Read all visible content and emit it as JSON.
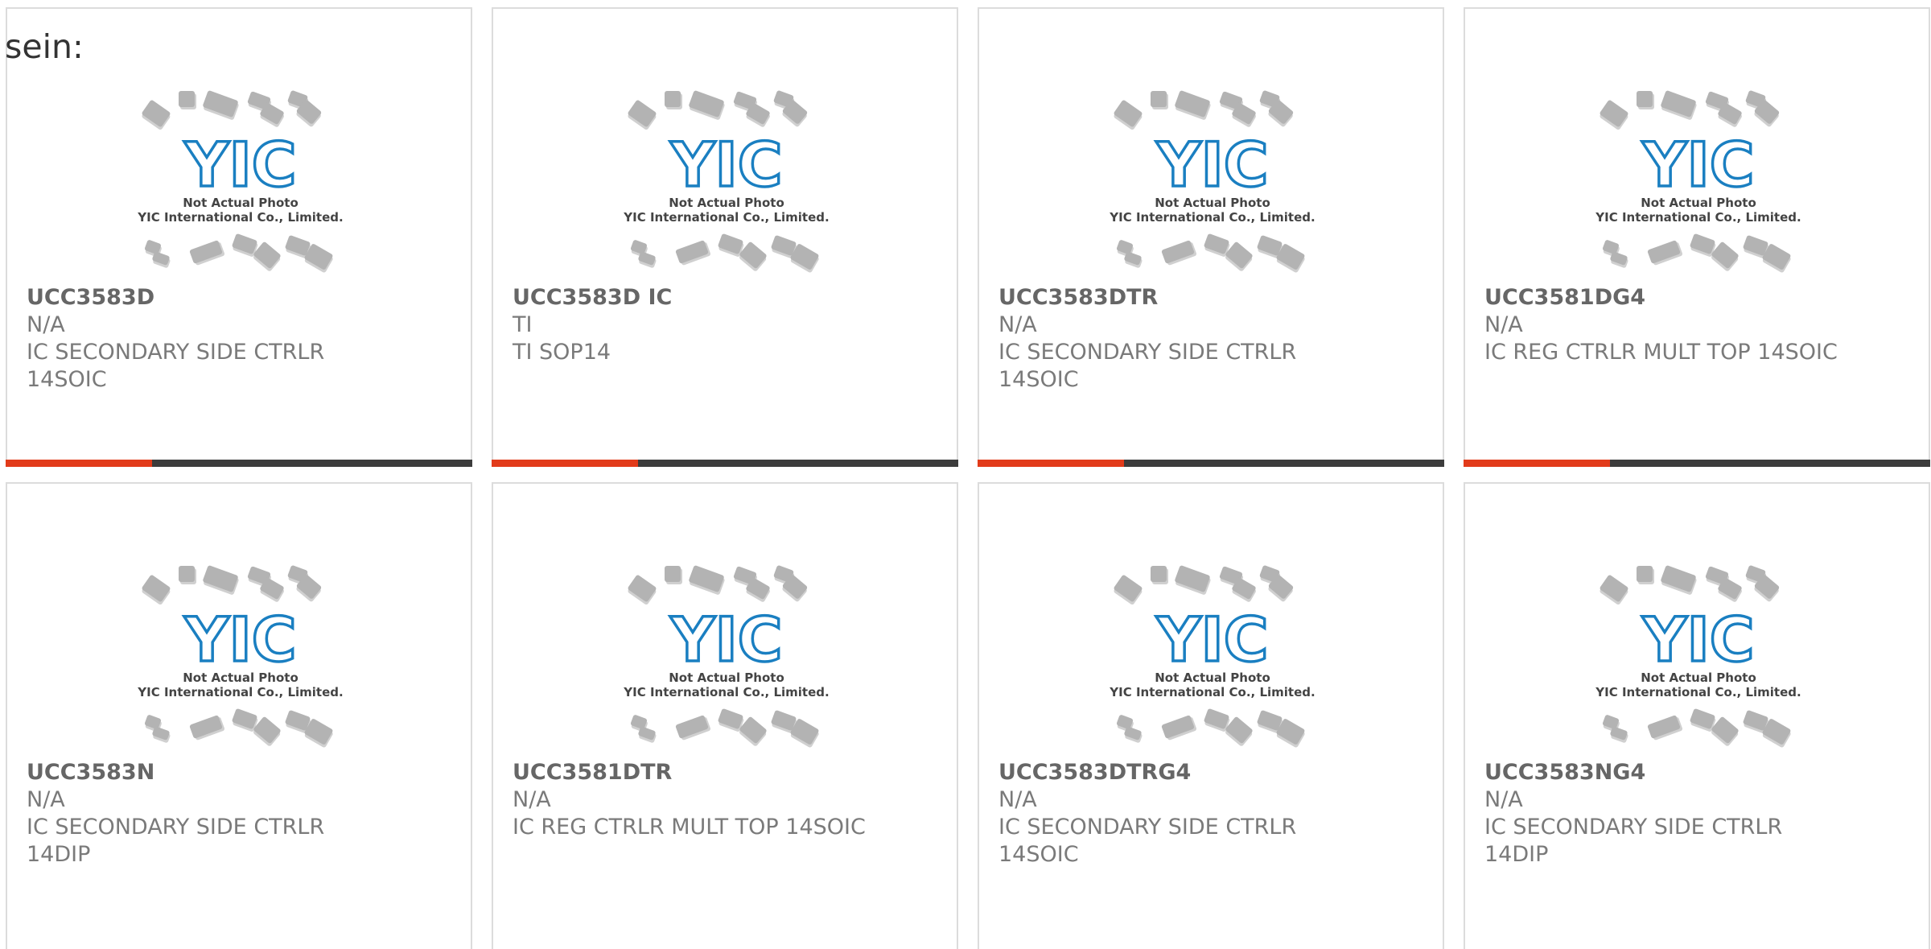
{
  "intro_text": "sein:",
  "photo": {
    "logo": "YIC",
    "caption_line1": "Not Actual Photo",
    "caption_line2": "YIC International Co., Limited."
  },
  "colors": {
    "accent": "#e23b1a",
    "bar": "#3c3c3c",
    "logo_blue": "#1a7fc1",
    "chip_gray": "#b3b3b3"
  },
  "products": [
    {
      "part": "UCC3583D",
      "brand": "N/A",
      "desc": [
        "IC SECONDARY SIDE CTRLR",
        "14SOIC"
      ]
    },
    {
      "part": "UCC3583D IC",
      "brand": "TI",
      "desc": [
        "TI SOP14"
      ]
    },
    {
      "part": "UCC3583DTR",
      "brand": "N/A",
      "desc": [
        "IC SECONDARY SIDE CTRLR",
        "14SOIC"
      ]
    },
    {
      "part": "UCC3581DG4",
      "brand": "N/A",
      "desc": [
        "IC REG CTRLR MULT TOP 14SOIC"
      ]
    },
    {
      "part": "UCC3583N",
      "brand": "N/A",
      "desc": [
        "IC SECONDARY SIDE CTRLR",
        "14DIP"
      ]
    },
    {
      "part": "UCC3581DTR",
      "brand": "N/A",
      "desc": [
        "IC REG CTRLR MULT TOP 14SOIC"
      ]
    },
    {
      "part": "UCC3583DTRG4",
      "brand": "N/A",
      "desc": [
        "IC SECONDARY SIDE CTRLR",
        "14SOIC"
      ]
    },
    {
      "part": "UCC3583NG4",
      "brand": "N/A",
      "desc": [
        "IC SECONDARY SIDE CTRLR",
        "14DIP"
      ]
    }
  ]
}
